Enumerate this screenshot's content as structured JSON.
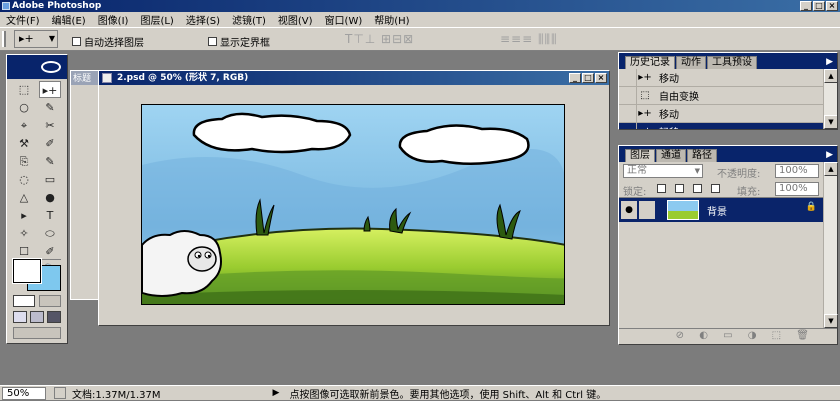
{
  "app": {
    "title": "Adobe Photoshop",
    "win_min": "_",
    "win_max": "□",
    "win_close": "×"
  },
  "menu": [
    "文件(F)",
    "编辑(E)",
    "图像(I)",
    "图层(L)",
    "选择(S)",
    "滤镜(T)",
    "视图(V)",
    "窗口(W)",
    "帮助(H)"
  ],
  "options": {
    "tool_glyph": "▸+",
    "auto_select": "自动选择图层",
    "show_bounds": "显示定界框",
    "align_glyphs": "T⊤⊥ ⊞⊟⊠",
    "distribute_glyphs": "≡≡≡ ⫼⫼⫼"
  },
  "bgdoc": {
    "title": "标题"
  },
  "document": {
    "title": "2.psd @ 50% (形状 7, RGB)",
    "min": "_",
    "max": "□",
    "close": "×"
  },
  "history_panel": {
    "tabs": [
      "历史记录",
      "动作",
      "工具预设"
    ],
    "items": [
      {
        "label": "移动",
        "icon": "▸+"
      },
      {
        "label": "自由变换",
        "icon": "⬚"
      },
      {
        "label": "移动",
        "icon": "▸+"
      },
      {
        "label": "轻移",
        "icon": "▸+",
        "active": true
      }
    ]
  },
  "layers_panel": {
    "tabs": [
      "图层",
      "通道",
      "路径"
    ],
    "blend_mode": "正常",
    "opacity_label": "不透明度:",
    "opacity": "100%",
    "lock_label": "锁定:",
    "fill_label": "填充:",
    "fill": "100%",
    "layer_name": "背景",
    "eye": "●",
    "lock_icon": "🔒",
    "bottom_icons": "⊘ ◐ ▭ ◑ ⬚ 🗑"
  },
  "status": {
    "zoom": "50%",
    "doc_info": "文档:1.37M/1.37M",
    "arrow": "▶",
    "hint": "点按图像可选取新前景色。要用其他选项，使用 Shift、Alt 和 Ctrl 键。"
  },
  "tools": [
    "⬚",
    "▸+",
    "○",
    "✎",
    "⌖",
    "✂",
    "⚒",
    "✐",
    "⎘",
    "✎",
    "◌",
    "▭",
    "△",
    "●",
    "▸",
    "T",
    "✧",
    "⬭",
    "☐",
    "✐",
    "✋",
    "🔍"
  ]
}
